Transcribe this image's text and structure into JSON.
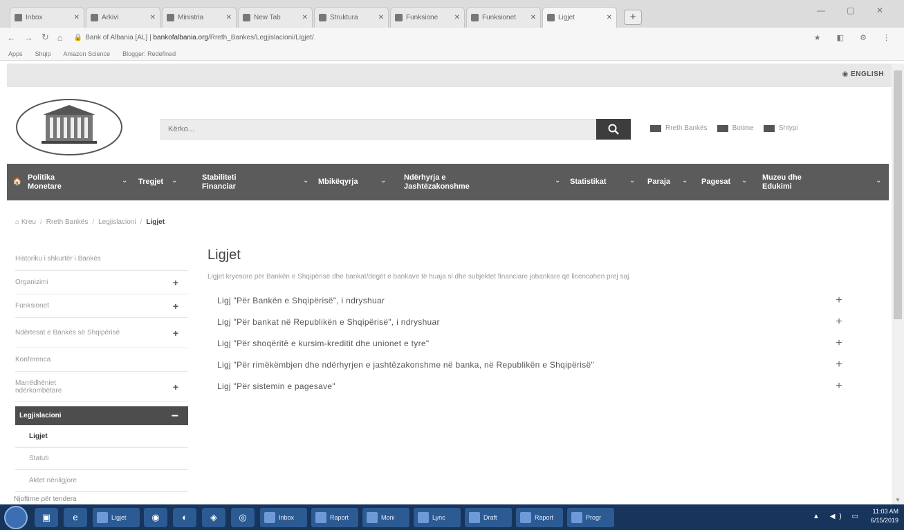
{
  "browser": {
    "tabs": [
      {
        "label": "Inbox",
        "active": false
      },
      {
        "label": "Arkivi",
        "active": false
      },
      {
        "label": "Ministria",
        "active": false
      },
      {
        "label": "New Tab",
        "active": false
      },
      {
        "label": "Struktura",
        "active": false
      },
      {
        "label": "Funksione",
        "active": false
      },
      {
        "label": "Funksionet",
        "active": false
      },
      {
        "label": "Ligjet",
        "active": true
      }
    ],
    "new_tab": "+",
    "url_site_label": "Bank of Albania [AL]",
    "url_host": "bankofalbania.org",
    "url_path": "/Rreth_Bankes/Legjislacioni/Ligjet/",
    "bookmarks": [
      "Apps",
      "Shqip",
      "Amazon Science",
      "Blogger: Redefined"
    ]
  },
  "site": {
    "language_link": "ENGLISH",
    "logo_alt": "BANKA E SHQIPERISE - BANK OF ALBANIA",
    "search_placeholder": "Kërko...",
    "header_links": [
      {
        "label": "Rreth Bankës",
        "icon": "bank-icon"
      },
      {
        "label": "Botime",
        "icon": "book-icon"
      },
      {
        "label": "Shtypi",
        "icon": "press-icon"
      }
    ],
    "nav": [
      {
        "label": "Politika Monetare",
        "has_chevron": true
      },
      {
        "label": "Tregjet",
        "has_chevron": true
      },
      {
        "label": "Stabiliteti Financiar",
        "has_chevron": true
      },
      {
        "label": "Mbikëqyrja",
        "has_chevron": true
      },
      {
        "label": "Ndërhyrja e Jashtëzakonshme",
        "has_chevron": true
      },
      {
        "label": "Statistikat",
        "has_chevron": true
      },
      {
        "label": "Paraja",
        "has_chevron": true
      },
      {
        "label": "Pagesat",
        "has_chevron": true
      },
      {
        "label": "Muzeu dhe Edukimi",
        "has_chevron": true
      }
    ],
    "breadcrumb": [
      "Kreu",
      "Rreth Bankës",
      "Legjislacioni",
      "Ligjet"
    ],
    "sidebar": [
      {
        "label": "Historiku i shkurtër i Bankës",
        "expandable": false
      },
      {
        "label": "Organizimi",
        "expandable": true
      },
      {
        "label": "Funksionet",
        "expandable": true
      },
      {
        "label": "Ndërtesat e Bankës së Shqipërisë",
        "expandable": true
      },
      {
        "label": "Konferenca",
        "expandable": false
      },
      {
        "label": "Marrëdhëniet ndërkombëtare",
        "expandable": true
      },
      {
        "label": "Legjislacioni",
        "expandable": true,
        "active": true
      }
    ],
    "sidebar_sub": [
      {
        "label": "Ligjet",
        "current": true
      },
      {
        "label": "Statuti",
        "current": false
      },
      {
        "label": "Aktet nënligjore",
        "current": false
      }
    ],
    "sidebar_tail": "Njoftime për tendera",
    "content": {
      "title": "Ligjet",
      "intro": "Ligjet kryesore për Bankën e Shqipërisë dhe bankat/degët e bankave të huaja si dhe subjektet financiare jobankare që licencohen prej saj.",
      "laws": [
        "Ligj \"Për Bankën e Shqipërisë\", i ndryshuar",
        "Ligj \"Për bankat në Republikën e Shqipërisë\", i ndryshuar",
        "Ligj \"Për shoqëritë e kursim-kreditit dhe unionet e tyre\"",
        "Ligj \"Për rimëkëmbjen dhe ndërhyrjen e jashtëzakonshme në banka, në Republikën e Shqipërisë\"",
        "Ligj \"Për sistemin e pagesave\""
      ]
    }
  },
  "taskbar": {
    "tasks": [
      "Ligjet",
      "Inbox",
      "Raport",
      "Moni",
      "Lync",
      "Draft",
      "Raport",
      "Progr"
    ],
    "time": "11:03 AM",
    "date": "6/15/2019"
  },
  "colors": {
    "nav_bg": "#5b5b5b",
    "active_sidebar_bg": "#4d4d4d",
    "taskbar_bg": "#16345c"
  }
}
